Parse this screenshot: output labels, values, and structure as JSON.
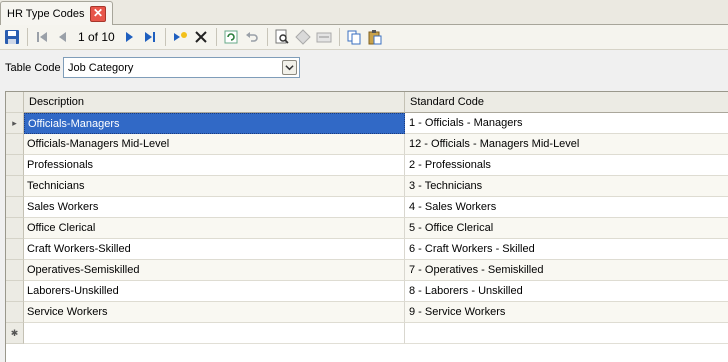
{
  "tab": {
    "title": "HR Type Codes",
    "close_glyph": "✕"
  },
  "toolbar": {
    "record_position": "1 of 10",
    "icons": [
      "save-icon",
      "first-record-icon",
      "previous-record-icon",
      "next-record-icon",
      "last-record-icon",
      "new-record-icon",
      "delete-icon",
      "refresh-icon",
      "undo-icon",
      "preview-icon",
      "edit-icon",
      "form-icon",
      "copy-icon",
      "paste-icon"
    ]
  },
  "table_code": {
    "label": "Table Code",
    "value": "Job Category"
  },
  "grid": {
    "columns": [
      "Description",
      "Standard Code"
    ],
    "rows": [
      {
        "description": "Officials-Managers",
        "standard_code": "1 - Officials - Managers"
      },
      {
        "description": "Officials-Managers Mid-Level",
        "standard_code": "12 - Officials - Managers Mid-Level"
      },
      {
        "description": "Professionals",
        "standard_code": "2 - Professionals"
      },
      {
        "description": "Technicians",
        "standard_code": "3 - Technicians"
      },
      {
        "description": "Sales Workers",
        "standard_code": "4 - Sales Workers"
      },
      {
        "description": "Office Clerical",
        "standard_code": "5 - Office Clerical"
      },
      {
        "description": "Craft Workers-Skilled",
        "standard_code": "6 - Craft Workers - Skilled"
      },
      {
        "description": "Operatives-Semiskilled",
        "standard_code": "7 - Operatives - Semiskilled"
      },
      {
        "description": "Laborers-Unskilled",
        "standard_code": "8 - Laborers - Unskilled"
      },
      {
        "description": "Service Workers",
        "standard_code": "9 - Service Workers"
      }
    ],
    "selected_row_marker": "▸",
    "new_row_marker": "✱"
  }
}
